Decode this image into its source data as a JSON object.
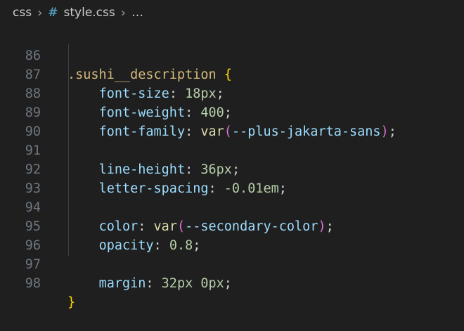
{
  "breadcrumb": {
    "folder": "css",
    "file": "style.css",
    "more": "…",
    "hash_symbol": "#"
  },
  "editor": {
    "lines": [
      {
        "n": "86"
      },
      {
        "n": "87"
      },
      {
        "n": "88"
      },
      {
        "n": "89"
      },
      {
        "n": "90"
      },
      {
        "n": "91"
      },
      {
        "n": "92"
      },
      {
        "n": "93"
      },
      {
        "n": "94"
      },
      {
        "n": "95"
      },
      {
        "n": "96"
      },
      {
        "n": "97"
      },
      {
        "n": "98"
      }
    ],
    "tokens": {
      "selector": ".sushi__description",
      "open_brace": "{",
      "close_brace": "}",
      "font_size_prop": "font-size",
      "font_size_val": "18px",
      "font_weight_prop": "font-weight",
      "font_weight_val": "400",
      "font_family_prop": "font-family",
      "font_family_fn": "var",
      "font_family_var": "--plus-jakarta-sans",
      "line_height_prop": "line-height",
      "line_height_val": "36px",
      "letter_spacing_prop": "letter-spacing",
      "letter_spacing_val": "-0.01em",
      "color_prop": "color",
      "color_fn": "var",
      "color_var": "--secondary-color",
      "opacity_prop": "opacity",
      "opacity_val": "0.8",
      "margin_prop": "margin",
      "margin_val": "32px 0px"
    }
  }
}
